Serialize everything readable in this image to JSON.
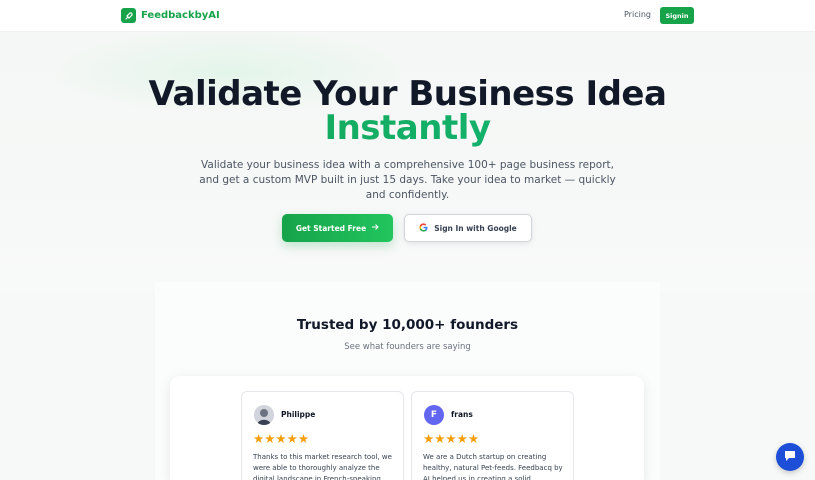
{
  "brand": {
    "name": "FeedbackbyAI",
    "color": "#16a34a"
  },
  "nav": {
    "pricing": "Pricing",
    "signin": "Signin"
  },
  "hero": {
    "title": "Validate Your Business Idea",
    "title_accent": "Instantly",
    "subtitle": "Validate your business idea with a comprehensive 100+ page business report, and get a custom MVP built in just 15 days. Take your idea to market — quickly and confidently.",
    "primary_cta": "Get Started Free",
    "primary_cta_icon": "arrow-right-icon",
    "google_cta": "Sign In with Google",
    "google_icon": "google-icon"
  },
  "testimonials": {
    "title": "Trusted by 10,000+ founders",
    "subtitle": "See what founders are saying",
    "items": [
      {
        "name": "Philippe",
        "avatar": "photo",
        "stars": "★★★★★",
        "text": "Thanks to this market research tool, we were able to thoroughly analyze the digital landscape in French-speaking"
      },
      {
        "name": "frans",
        "avatar": "F",
        "stars": "★★★★★",
        "text": "We are a Dutch startup on creating healthy, natural Pet-feeds. Feedbacq by AI helped us in creating a solid"
      }
    ]
  },
  "chat": {
    "icon": "chat-icon",
    "color": "#1d4ed8"
  }
}
